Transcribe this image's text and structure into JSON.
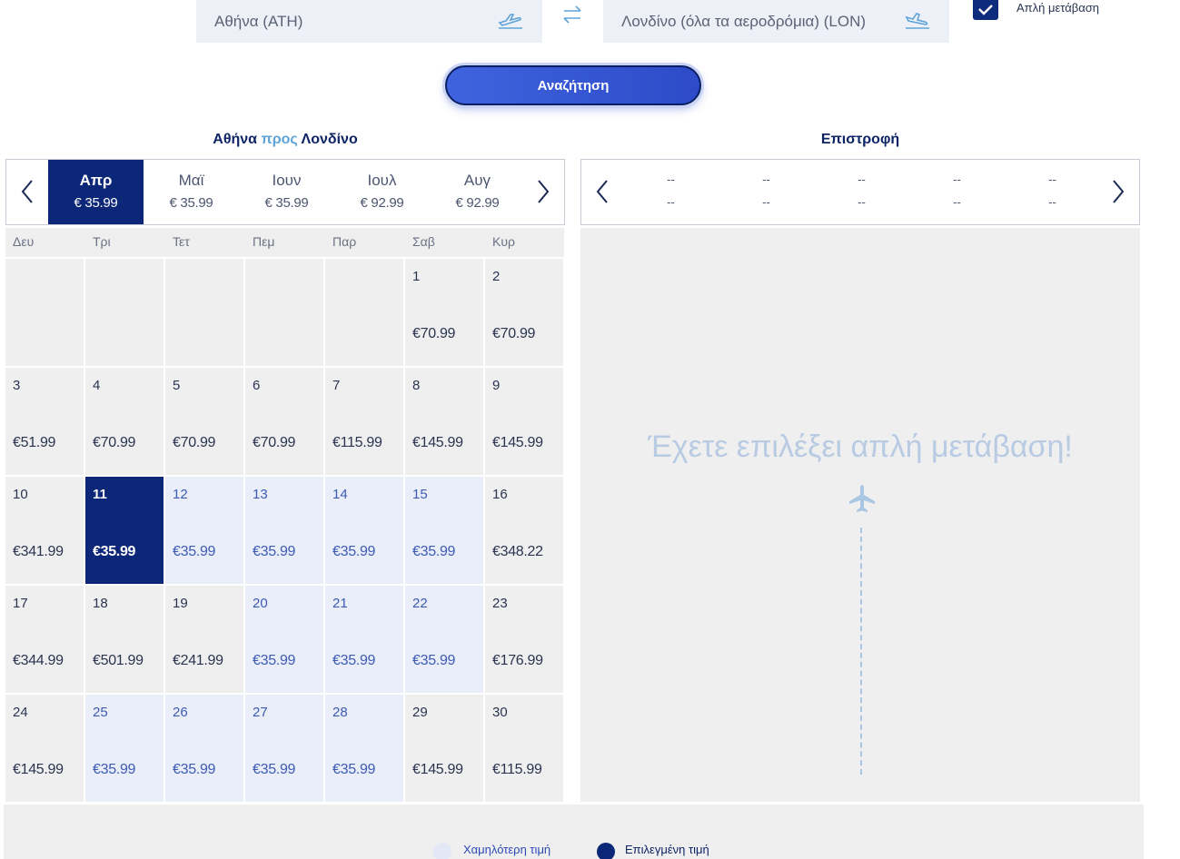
{
  "search": {
    "from": "Αθήνα (ATH)",
    "to": "Λονδίνο (όλα τα αεροδρόμια) (LON)",
    "one_way_label": "Απλή μετάβαση",
    "one_way_checked": true,
    "search_button": "Αναζήτηση"
  },
  "outbound": {
    "title_from": "Αθήνα",
    "title_to_word": "προς",
    "title_to": "Λονδίνο",
    "months": [
      {
        "name": "Απρ",
        "price": "€ 35.99",
        "active": true
      },
      {
        "name": "Μαϊ",
        "price": "€ 35.99",
        "active": false
      },
      {
        "name": "Ιουν",
        "price": "€ 35.99",
        "active": false
      },
      {
        "name": "Ιουλ",
        "price": "€ 92.99",
        "active": false
      },
      {
        "name": "Αυγ",
        "price": "€ 92.99",
        "active": false
      }
    ],
    "weekdays": [
      "Δευ",
      "Τρι",
      "Τετ",
      "Πεμ",
      "Παρ",
      "Σαβ",
      "Κυρ"
    ],
    "weeks": [
      [
        null,
        null,
        null,
        null,
        null,
        {
          "day": "1",
          "price": "€70.99"
        },
        {
          "day": "2",
          "price": "€70.99"
        }
      ],
      [
        {
          "day": "3",
          "price": "€51.99"
        },
        {
          "day": "4",
          "price": "€70.99"
        },
        {
          "day": "5",
          "price": "€70.99"
        },
        {
          "day": "6",
          "price": "€70.99"
        },
        {
          "day": "7",
          "price": "€115.99"
        },
        {
          "day": "8",
          "price": "€145.99"
        },
        {
          "day": "9",
          "price": "€145.99"
        }
      ],
      [
        {
          "day": "10",
          "price": "€341.99"
        },
        {
          "day": "11",
          "price": "€35.99",
          "state": "selected"
        },
        {
          "day": "12",
          "price": "€35.99",
          "state": "lowest"
        },
        {
          "day": "13",
          "price": "€35.99",
          "state": "lowest"
        },
        {
          "day": "14",
          "price": "€35.99",
          "state": "lowest"
        },
        {
          "day": "15",
          "price": "€35.99",
          "state": "lowest"
        },
        {
          "day": "16",
          "price": "€348.22"
        }
      ],
      [
        {
          "day": "17",
          "price": "€344.99"
        },
        {
          "day": "18",
          "price": "€501.99"
        },
        {
          "day": "19",
          "price": "€241.99"
        },
        {
          "day": "20",
          "price": "€35.99",
          "state": "lowest"
        },
        {
          "day": "21",
          "price": "€35.99",
          "state": "lowest"
        },
        {
          "day": "22",
          "price": "€35.99",
          "state": "lowest"
        },
        {
          "day": "23",
          "price": "€176.99"
        }
      ],
      [
        {
          "day": "24",
          "price": "€145.99"
        },
        {
          "day": "25",
          "price": "€35.99",
          "state": "lowest"
        },
        {
          "day": "26",
          "price": "€35.99",
          "state": "lowest"
        },
        {
          "day": "27",
          "price": "€35.99",
          "state": "lowest"
        },
        {
          "day": "28",
          "price": "€35.99",
          "state": "lowest"
        },
        {
          "day": "29",
          "price": "€145.99"
        },
        {
          "day": "30",
          "price": "€115.99"
        }
      ]
    ]
  },
  "return": {
    "title": "Επιστροφή",
    "placeholder_month": "--",
    "placeholder_price": "--",
    "slots": 5,
    "message": "Έχετε επιλέξει απλή μετάβαση!"
  },
  "legend": {
    "lowest": "Χαμηλότερη τιμή",
    "selected": "Επιλεγμένη τιμή"
  },
  "colors": {
    "selected": "#0c2777",
    "lowest_bg": "#e9eef9",
    "accent": "#3f63de"
  }
}
